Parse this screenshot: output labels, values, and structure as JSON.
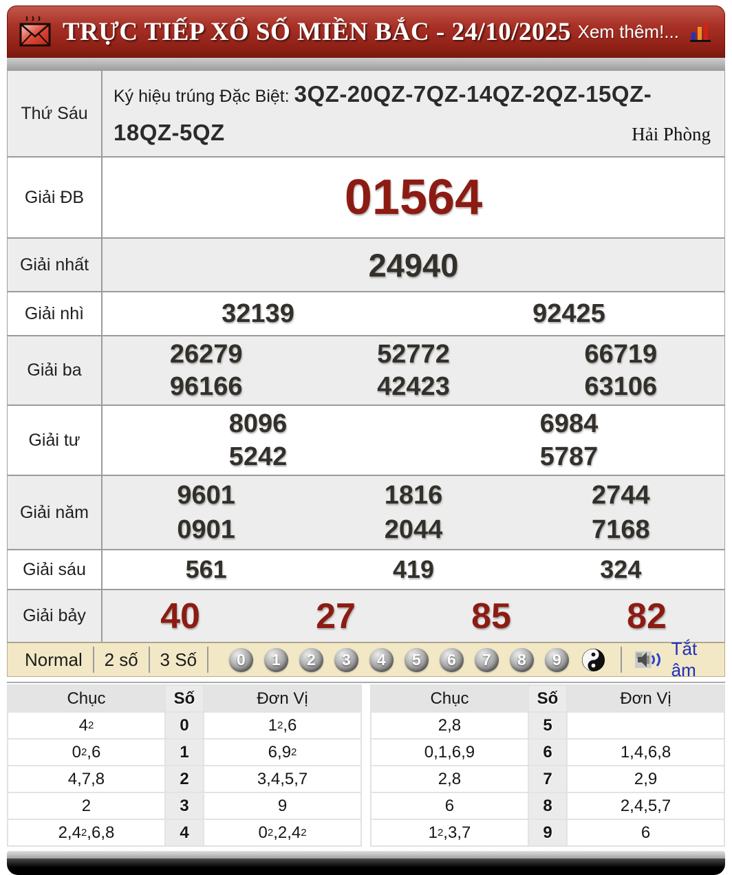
{
  "header": {
    "title": "TRỰC TIẾP XỔ SỐ MIỀN BẮC - 24/10/2025",
    "more_label": "Xem thêm!..."
  },
  "results": {
    "day_label": "Thứ Sáu",
    "sign_prefix": "Ký hiệu trúng Đặc Biệt: ",
    "sign_code": "3QZ-20QZ-7QZ-14QZ-2QZ-15QZ-18QZ-5QZ",
    "province": "Hải Phòng",
    "rows": [
      {
        "variant": "db",
        "label": "Giải ĐB",
        "lines": [
          [
            "01564"
          ]
        ]
      },
      {
        "variant": "nhat",
        "label": "Giải nhất",
        "lines": [
          [
            "24940"
          ]
        ]
      },
      {
        "variant": "nhi",
        "label": "Giải nhì",
        "lines": [
          [
            "32139",
            "92425"
          ]
        ]
      },
      {
        "variant": "ba",
        "label": "Giải ba",
        "lines": [
          [
            "26279",
            "52772",
            "66719"
          ],
          [
            "96166",
            "42423",
            "63106"
          ]
        ]
      },
      {
        "variant": "tu",
        "label": "Giải tư",
        "lines": [
          [
            "8096",
            "6984"
          ],
          [
            "5242",
            "5787"
          ]
        ]
      },
      {
        "variant": "nam",
        "label": "Giải năm",
        "lines": [
          [
            "9601",
            "1816",
            "2744"
          ],
          [
            "0901",
            "2044",
            "7168"
          ]
        ]
      },
      {
        "variant": "sau",
        "label": "Giải sáu",
        "lines": [
          [
            "561",
            "419",
            "324"
          ]
        ]
      },
      {
        "variant": "bay",
        "label": "Giải bảy",
        "lines": [
          [
            "40",
            "27",
            "85",
            "82"
          ]
        ]
      }
    ]
  },
  "toolbar": {
    "modes": [
      "Normal",
      "2 số",
      "3 Số"
    ],
    "balls": [
      "0",
      "1",
      "2",
      "3",
      "4",
      "5",
      "6",
      "7",
      "8",
      "9"
    ],
    "mute_label": "Tắt âm"
  },
  "stats": {
    "headers": [
      "Chục",
      "Số",
      "Đơn Vị"
    ],
    "left_rows": [
      {
        "chuc": "4^2",
        "so": "0",
        "donvi": "1^2,6"
      },
      {
        "chuc": "0^2,6",
        "so": "1",
        "donvi": "6,9^2"
      },
      {
        "chuc": "4,7,8",
        "so": "2",
        "donvi": "3,4,5,7"
      },
      {
        "chuc": "2",
        "so": "3",
        "donvi": "9"
      },
      {
        "chuc": "2,4^2,6,8",
        "so": "4",
        "donvi": "0^2,2,4^2"
      }
    ],
    "right_rows": [
      {
        "chuc": "2,8",
        "so": "5",
        "donvi": ""
      },
      {
        "chuc": "0,1,6,9",
        "so": "6",
        "donvi": "1,4,6,8"
      },
      {
        "chuc": "2,8",
        "so": "7",
        "donvi": "2,9"
      },
      {
        "chuc": "6",
        "so": "8",
        "donvi": "2,4,5,7"
      },
      {
        "chuc": "1^2,3,7",
        "so": "9",
        "donvi": "6"
      }
    ]
  },
  "colors": {
    "header_red": "#a93126",
    "special_red": "#8c1c13",
    "toolbar_beige": "#f2e8c5",
    "link_blue": "#1f2ec2",
    "number_dark": "#33302b"
  }
}
